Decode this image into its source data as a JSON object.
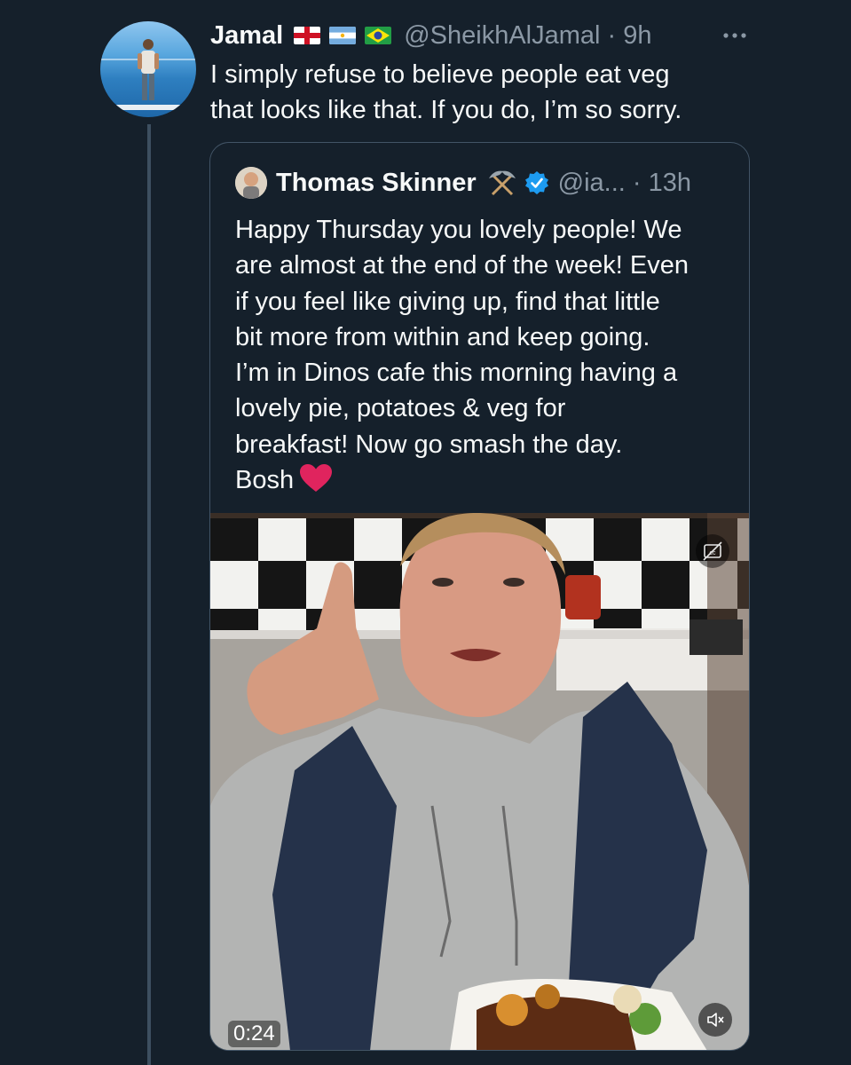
{
  "tweet": {
    "author_name": "Jamal",
    "handle_time": "@SheikhAlJamal · 9h",
    "text": "I simply refuse to believe people eat veg\nthat looks like that. If you do, I’m so sorry.",
    "flags": [
      "england-flag",
      "argentina-flag",
      "brazil-flag"
    ]
  },
  "quote": {
    "author_name": "Thomas Skinner",
    "handle_time": "@ia... · 13h",
    "text": "Happy Thursday you lovely people! We\nare almost at the end of the week! Even\nif you feel like giving up, find that little\nbit more from within and keep going.\nI’m in Dinos cafe this morning having a\nlovely pie, potatoes & veg for\nbreakfast! Now go smash the day.\nBosh",
    "video": {
      "duration": "0:24"
    }
  },
  "icons": {
    "more": "more-icon",
    "pick": "pick-icon",
    "verified": "verified-icon",
    "heart": "heart-icon",
    "captions": "captions-off-icon",
    "mute": "mute-icon"
  },
  "colors": {
    "background": "#15202b",
    "text": "#f7f9f9",
    "secondary_text": "#8b98a5",
    "verified_blue": "#1d9bf0",
    "heart_red": "#e0245e"
  }
}
